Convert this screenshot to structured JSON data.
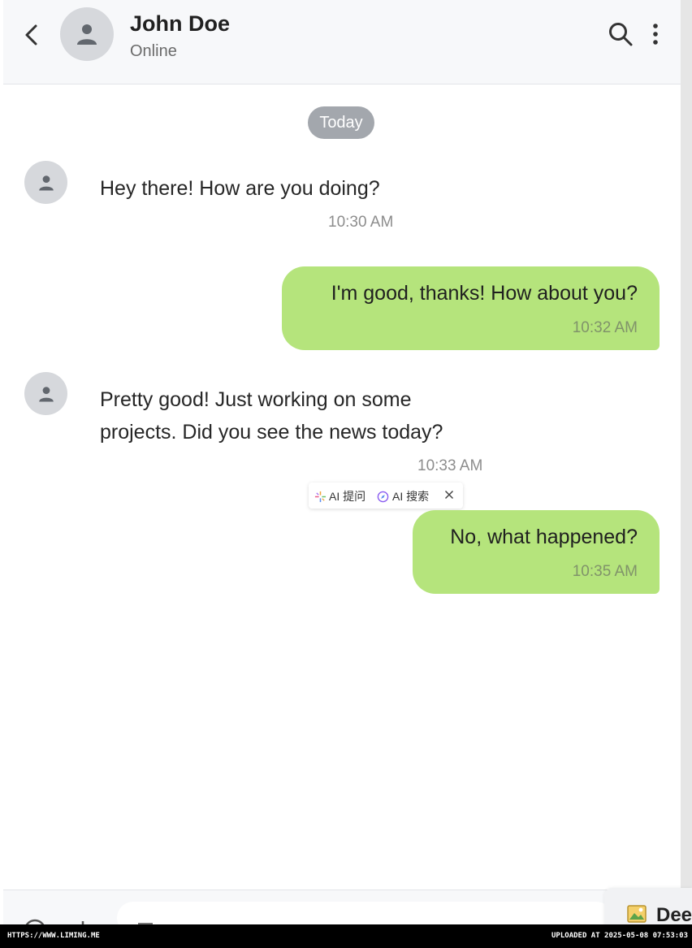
{
  "header": {
    "contact_name": "John Doe",
    "status": "Online"
  },
  "date_divider": "Today",
  "messages": [
    {
      "direction": "in",
      "lines": [
        "Hey there! How are you doing?"
      ],
      "time": "10:30 AM"
    },
    {
      "direction": "out",
      "lines": [
        "I'm good, thanks! How about you?"
      ],
      "time": "10:32 AM"
    },
    {
      "direction": "in",
      "lines": [
        "Pretty good! Just working on some",
        "projects. Did you see the news today?"
      ],
      "time": "10:33 AM"
    },
    {
      "direction": "out",
      "lines": [
        "No, what happened?"
      ],
      "time": "10:35 AM"
    }
  ],
  "ai_toolbar": {
    "ask_label": "AI 提问",
    "search_label": "AI 搜索"
  },
  "deep_button": {
    "label": "Dee"
  },
  "footer": {
    "url": "HTTPS://WWW.LIMING.ME",
    "uploaded": "UPLOADED AT 2025-05-08 07:53:03"
  },
  "colors": {
    "outgoing_bubble": "#b5e47c",
    "date_chip": "#a3a7ad",
    "header_bg": "#f7f8fa"
  },
  "icons": [
    "back-arrow-icon",
    "person-icon",
    "search-icon",
    "more-vertical-icon",
    "sparkle-icon",
    "compass-icon",
    "close-icon",
    "image-icon"
  ]
}
